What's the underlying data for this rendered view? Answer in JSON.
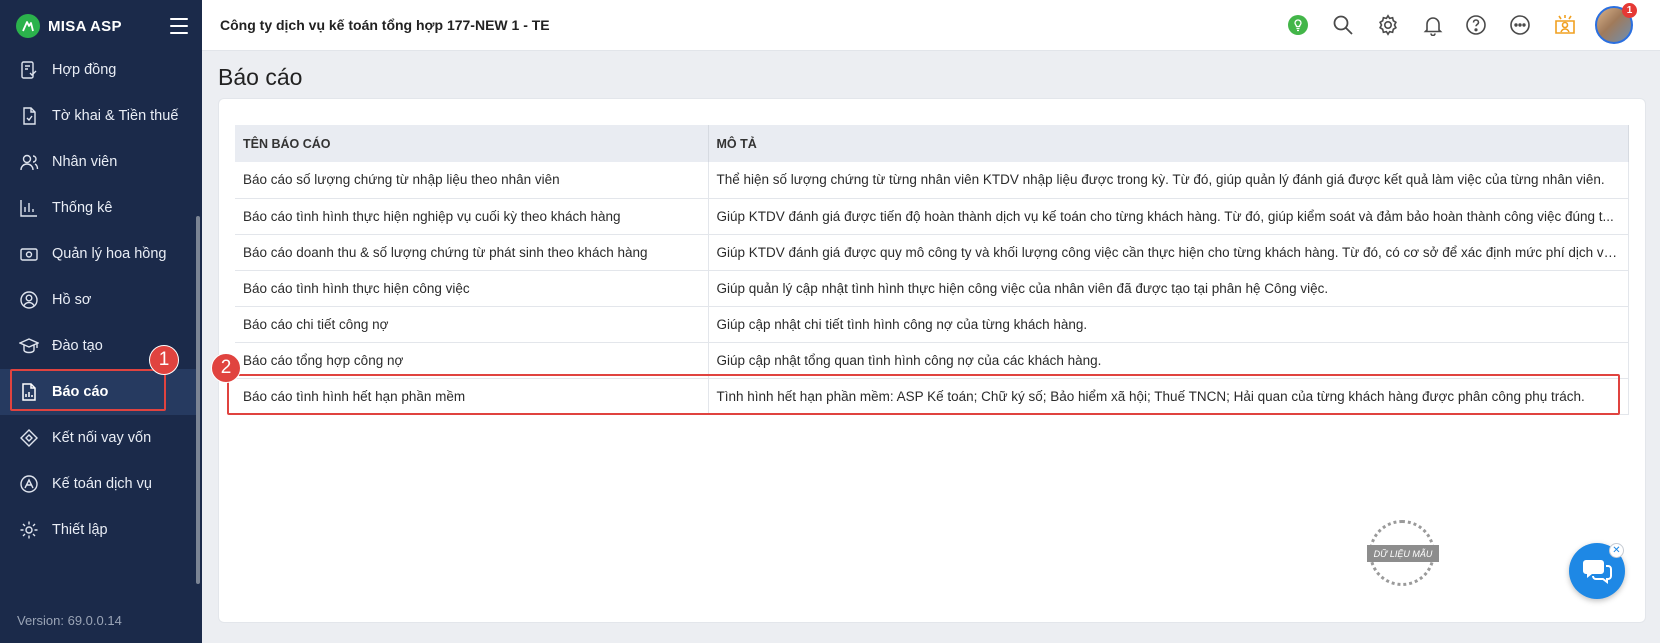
{
  "brand": {
    "name": "MISA ASP"
  },
  "sidebar": {
    "items": [
      {
        "label": "Hợp đồng",
        "icon": "contract-icon"
      },
      {
        "label": "Tờ khai & Tiền thuế",
        "icon": "tax-declaration-icon"
      },
      {
        "label": "Nhân viên",
        "icon": "employees-icon"
      },
      {
        "label": "Thống kê",
        "icon": "statistics-icon"
      },
      {
        "label": "Quản lý hoa hồng",
        "icon": "commission-icon"
      },
      {
        "label": "Hồ sơ",
        "icon": "profile-icon"
      },
      {
        "label": "Đào tạo",
        "icon": "training-icon"
      },
      {
        "label": "Báo cáo",
        "icon": "report-icon",
        "active": true
      },
      {
        "label": "Kết nối vay vốn",
        "icon": "loan-connect-icon"
      },
      {
        "label": "Kế toán dịch vụ",
        "icon": "accounting-service-icon"
      },
      {
        "label": "Thiết lập",
        "icon": "settings-icon"
      }
    ],
    "version": "Version: 69.0.0.14"
  },
  "header": {
    "company": "Công ty dịch vụ kế toán tổng hợp 177-NEW 1 - TE",
    "notification_count": "1",
    "icons": [
      "idea-icon",
      "search-icon",
      "gear-icon",
      "bell-icon",
      "help-icon",
      "more-icon",
      "learning-icon"
    ]
  },
  "annotations": {
    "marker_1": "1",
    "marker_2": "2"
  },
  "page": {
    "title": "Báo cáo"
  },
  "table": {
    "columns": [
      "TÊN BÁO CÁO",
      "MÔ TẢ"
    ],
    "rows": [
      {
        "name": "Báo cáo số lượng chứng từ nhập liệu theo nhân viên",
        "desc": "Thể hiện số lượng chứng từ từng nhân viên KTDV nhập liệu được trong kỳ. Từ đó, giúp quản lý đánh giá được kết quả làm việc của từng nhân viên."
      },
      {
        "name": "Báo cáo tình hình thực hiện nghiệp vụ cuối kỳ theo khách hàng",
        "desc": "Giúp KTDV đánh giá được tiến độ hoàn thành dịch vụ kế toán cho từng khách hàng. Từ đó, giúp kiểm soát và đảm bảo hoàn thành công việc đúng t..."
      },
      {
        "name": "Báo cáo doanh thu & số lượng chứng từ phát sinh theo khách hàng",
        "desc": "Giúp KTDV đánh giá được quy mô công ty và khối lượng công việc cần thực hiện cho từng khách hàng. Từ đó, có cơ sở để xác định mức phí dịch vụ..."
      },
      {
        "name": "Báo cáo tình hình thực hiện công việc",
        "desc": "Giúp quản lý cập nhật tình hình thực hiện công việc của nhân viên đã được tạo tại phân hệ Công việc."
      },
      {
        "name": "Báo cáo chi tiết công nợ",
        "desc": "Giúp cập nhật chi tiết tình hình công nợ của từng khách hàng."
      },
      {
        "name": "Báo cáo tổng hợp công nợ",
        "desc": "Giúp cập nhật tổng quan tình hình công nợ của các khách hàng."
      },
      {
        "name": "Báo cáo tình hình hết hạn phần mềm",
        "desc": "Tình hình hết hạn phần mềm: ASP Kế toán; Chữ ký số; Bảo hiểm xã hội; Thuế TNCN; Hải quan của từng khách hàng được phân công phụ trách."
      }
    ]
  },
  "watermark": {
    "text": "DỮ LIỆU MẪU"
  },
  "colors": {
    "sidebar_bg": "#1b2a4a",
    "accent": "#1e88e5",
    "annotation": "#e0433f",
    "brand_green": "#2bb24c"
  }
}
